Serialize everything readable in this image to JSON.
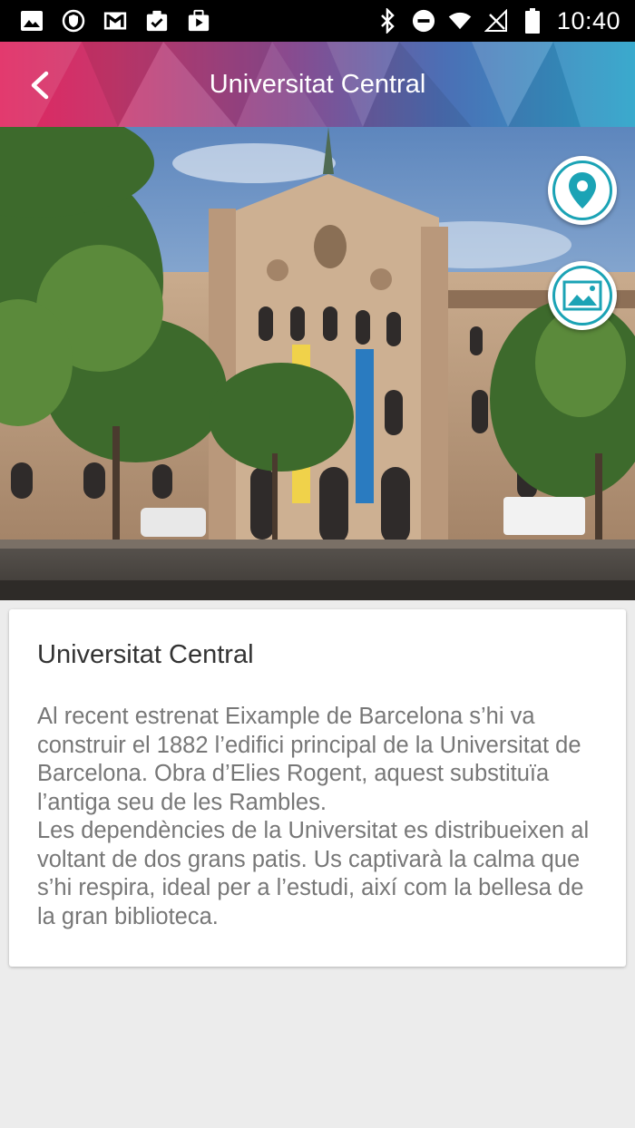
{
  "status_bar": {
    "time": "10:40",
    "left_icons": [
      "image-icon",
      "shield-icon",
      "gmail-icon",
      "clipboard-check-icon",
      "play-store-icon"
    ],
    "right_icons": [
      "bluetooth-icon",
      "do-not-disturb-icon",
      "wifi-icon",
      "no-signal-icon",
      "battery-icon"
    ]
  },
  "app_bar": {
    "title": "Universitat Central",
    "back_icon": "chevron-left-icon"
  },
  "hero": {
    "image_alt": "Universitat Central building",
    "buttons": [
      {
        "icon": "map-pin-icon"
      },
      {
        "icon": "gallery-icon"
      }
    ]
  },
  "card": {
    "title": "Universitat Central",
    "body": "Al recent estrenat Eixample de Barcelona s’hi va construir el 1882 l’edifici principal de la Universitat de Barcelona. Obra d’Elies Rogent, aquest substituïa l’antiga seu de les Rambles.\nLes dependències de la Universitat es distribueixen al voltant de dos grans patis. Us captivarà la calma que s’hi respira, ideal per a l’estudi, així com la bellesa de la gran biblioteca."
  },
  "colors": {
    "accent": "#1ba3b5",
    "header_start": "#e0245e",
    "header_end": "#2aa3c9",
    "background": "#ececec"
  }
}
